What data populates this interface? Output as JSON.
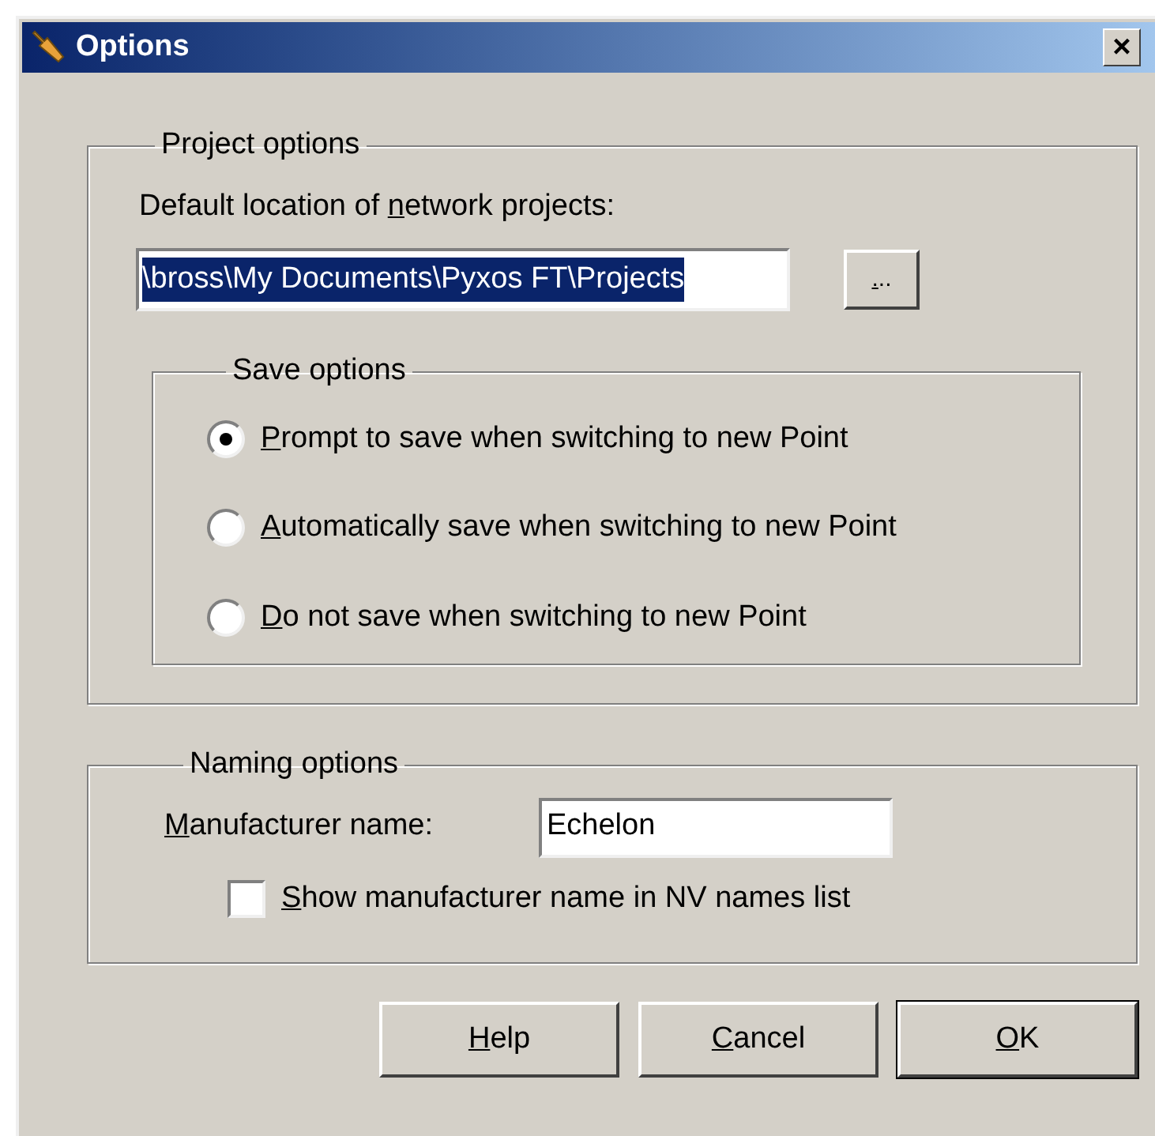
{
  "window": {
    "title": "Options",
    "close_label": "×"
  },
  "project_options": {
    "title": "Project options",
    "location_label": {
      "pre": "Default location of ",
      "key": "n",
      "post": "etwork projects:"
    },
    "location_value": "\\bross\\My Documents\\Pyxos FT\\Projects",
    "browse_button": {
      "key": ".",
      "post": ".."
    },
    "save_options": {
      "title": "Save options",
      "options": [
        {
          "label": {
            "key": "P",
            "post": "rompt to save when switching to new Point"
          },
          "selected": true
        },
        {
          "label": {
            "key": "A",
            "post": "utomatically save when switching to new Point"
          },
          "selected": false
        },
        {
          "label": {
            "key": "D",
            "post": "o not save when switching to new Point"
          },
          "selected": false
        }
      ]
    }
  },
  "naming_options": {
    "title": "Naming options",
    "manufacturer_label": {
      "key": "M",
      "post": "anufacturer name:"
    },
    "manufacturer_value": "Echelon",
    "show_in_list": {
      "label": {
        "key": "S",
        "post": "how manufacturer name in NV names list"
      },
      "checked": false
    }
  },
  "buttons": [
    {
      "label": {
        "key": "H",
        "post": "elp"
      },
      "default": false
    },
    {
      "label": {
        "key": "C",
        "post": "ancel"
      },
      "default": false
    },
    {
      "label": {
        "key": "O",
        "post": "K"
      },
      "default": true
    }
  ]
}
